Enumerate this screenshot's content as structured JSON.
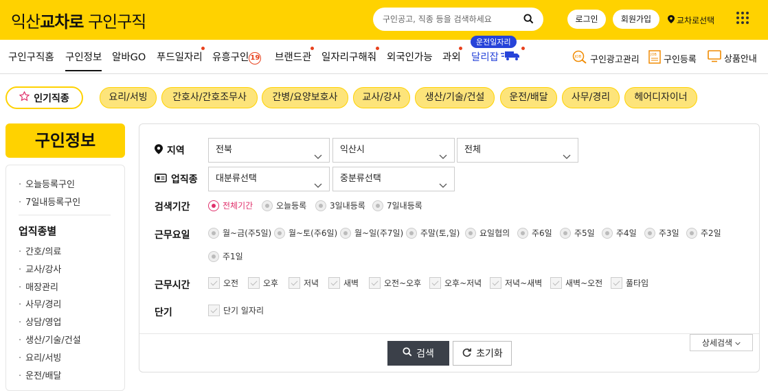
{
  "header": {
    "logo_city": "익산",
    "logo_brand": "교차로",
    "logo_suffix": "구인구직",
    "search_placeholder": "구인공고, 직종 등을 검색하세요",
    "login": "로그인",
    "signup": "회원가입",
    "location": "교차로선택"
  },
  "nav": {
    "items": [
      "구인구직홈",
      "구인정보",
      "알바GO",
      "푸드일자리",
      "유흥구인",
      "브랜드관",
      "일자리구해줘",
      "외국인가능",
      "과외",
      "달리잡"
    ],
    "badge19": "19",
    "driver_badge": "운전일자리",
    "right": [
      "구인광고관리",
      "구인등록",
      "상품안내"
    ],
    "job_icon_text": "JOB"
  },
  "categories": {
    "popular": "인기직종",
    "items": [
      "요리/서빙",
      "간호사/간호조무사",
      "간병/요양보호사",
      "교사/강사",
      "생산/기술/건설",
      "운전/배달",
      "사무/경리",
      "헤어디자이너"
    ]
  },
  "sidebar": {
    "title": "구인정보",
    "top_items": [
      "오늘등록구인",
      "7일내등록구인"
    ],
    "section_title": "업직종별",
    "items": [
      "간호/의료",
      "교사/강사",
      "매장관리",
      "사무/경리",
      "상담/영업",
      "생산/기술/건설",
      "요리/서빙",
      "운전/배달"
    ]
  },
  "filters": {
    "region_label": "지역",
    "region": [
      "전북",
      "익산시",
      "전체"
    ],
    "industry_label": "업직종",
    "industry": [
      "대분류선택",
      "중분류선택"
    ],
    "period_label": "검색기간",
    "period": [
      "전체기간",
      "오늘등록",
      "3일내등록",
      "7일내등록"
    ],
    "period_selected": "전체기간",
    "workdays_label": "근무요일",
    "workdays": [
      "월~금(주5일)",
      "월~토(주6일)",
      "월~일(주7일)",
      "주말(토,일)",
      "요일협의",
      "주6일",
      "주5일",
      "주4일",
      "주3일",
      "주2일",
      "주1일"
    ],
    "worktime_label": "근무시간",
    "worktime": [
      "오전",
      "오후",
      "저녁",
      "새벽",
      "오전~오후",
      "오후~저녁",
      "저녁~새벽",
      "새벽~오전",
      "풀타임"
    ],
    "short_label": "단기",
    "short": [
      "단기 일자리"
    ],
    "search_button": "검색",
    "reset_button": "초기화",
    "advanced_button": "상세검색"
  },
  "colors": {
    "brand": "#ffd200",
    "accent": "#e0306b",
    "nav_dot": "#e8401c",
    "driver": "#2643d9"
  }
}
